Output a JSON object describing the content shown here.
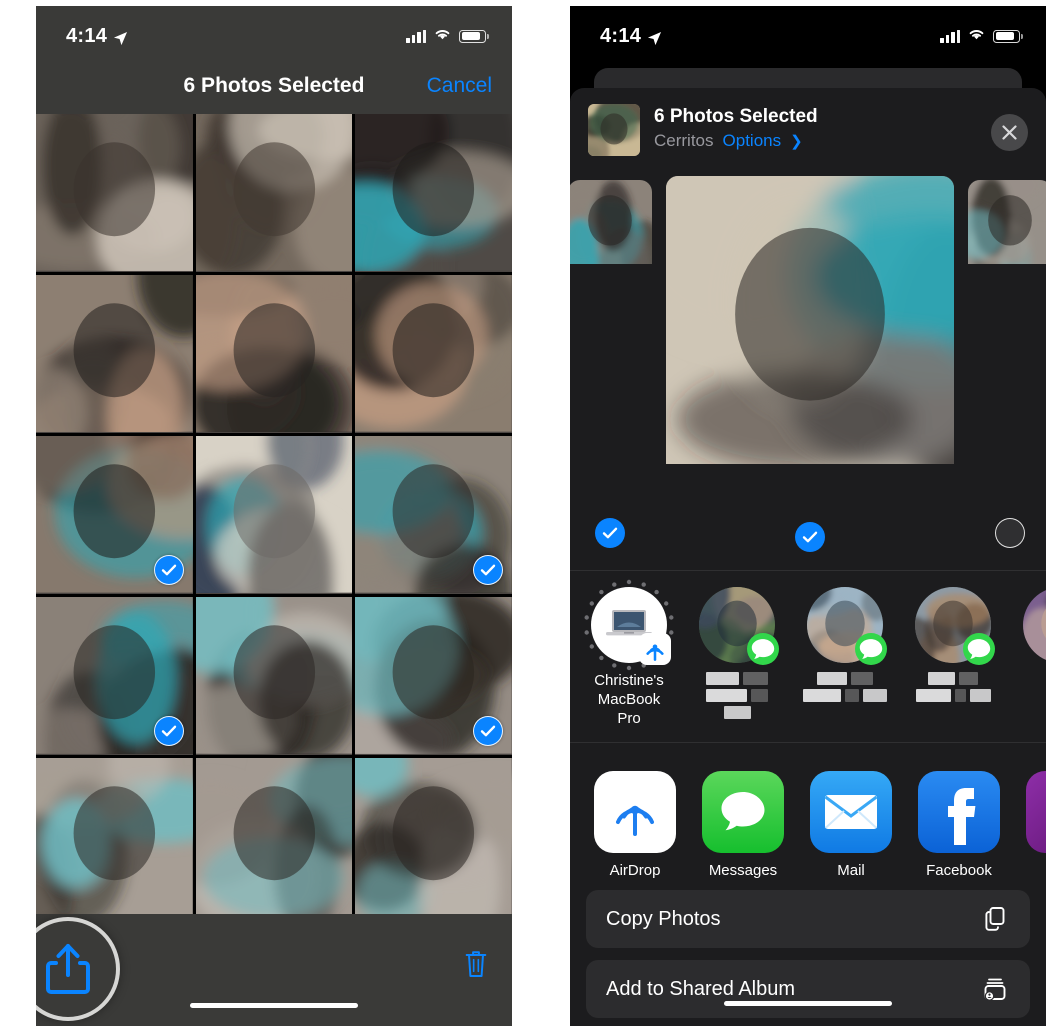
{
  "status_bar": {
    "time": "4:14",
    "location_icon": "location-arrow-icon",
    "signal_icon": "cellular-signal-icon",
    "wifi_icon": "wifi-icon",
    "battery_icon": "battery-icon"
  },
  "left_phone": {
    "nav": {
      "title": "6 Photos Selected",
      "cancel_label": "Cancel"
    },
    "grid": {
      "rows": 5,
      "columns": 3,
      "selected_count": 6,
      "cells": [
        {
          "id": "cell-1",
          "subject": "dog-paws-closeup",
          "selected": false
        },
        {
          "id": "cell-2",
          "subject": "dog-paws-closeup-2",
          "selected": false
        },
        {
          "id": "cell-3",
          "subject": "dog-in-teal-harness",
          "selected": false
        },
        {
          "id": "cell-4",
          "subject": "man-holding-dog",
          "selected": false
        },
        {
          "id": "cell-5",
          "subject": "man-holding-dog-2",
          "selected": false
        },
        {
          "id": "cell-6",
          "subject": "man-holding-dog-3",
          "selected": false
        },
        {
          "id": "cell-7",
          "subject": "man-kissing-dog",
          "selected": true
        },
        {
          "id": "cell-8",
          "subject": "dog-on-couch-mirror",
          "selected": false
        },
        {
          "id": "cell-9",
          "subject": "dog-sitting-couch",
          "selected": true
        },
        {
          "id": "cell-10",
          "subject": "dog-sitting-couch-2",
          "selected": true
        },
        {
          "id": "cell-11",
          "subject": "dog-lying-blanket",
          "selected": false
        },
        {
          "id": "cell-12",
          "subject": "dog-lying-blanket-2",
          "selected": true
        },
        {
          "id": "cell-13",
          "subject": "dog-resting-bed",
          "selected": false
        },
        {
          "id": "cell-14",
          "subject": "dog-resting-bed-2",
          "selected": false
        },
        {
          "id": "cell-15",
          "subject": "dog-resting-bed-3",
          "selected": false
        }
      ]
    },
    "toolbar": {
      "share_icon": "share-icon",
      "trash_icon": "trash-icon",
      "share_highlighted": true
    }
  },
  "right_phone": {
    "sheet": {
      "title": "6 Photos Selected",
      "subtitle": "Cerritos",
      "options_label": "Options",
      "options_chevron": "chevron-right-icon",
      "close_icon": "close-icon",
      "thumbnail": "dog-outdoor-thumbnail"
    },
    "preview": [
      {
        "id": "preview-left",
        "subject": "dog-sitting-couch-partial",
        "selected": true,
        "size": "side"
      },
      {
        "id": "preview-center",
        "subject": "dog-sitting-teal-harness",
        "selected": true,
        "size": "main"
      },
      {
        "id": "preview-right",
        "subject": "dog-lying-blanket-partial",
        "selected": false,
        "size": "side"
      }
    ],
    "airdrop": [
      {
        "id": "airdrop-macbook",
        "label": "Christine's MacBook Pro",
        "avatar": "macbook-pro-icon",
        "badge": "airdrop-icon",
        "redacted": false
      },
      {
        "id": "airdrop-contact-1",
        "label": "",
        "avatar": "contact-photo-man-outdoors",
        "badge": "messages-icon",
        "redacted": true
      },
      {
        "id": "airdrop-contact-2",
        "label": "",
        "avatar": "contact-photo-couple-lake",
        "badge": "messages-icon",
        "redacted": true
      },
      {
        "id": "airdrop-contact-3",
        "label": "",
        "avatar": "contact-photo-group",
        "badge": "messages-icon",
        "redacted": true
      },
      {
        "id": "airdrop-contact-4",
        "label": "",
        "avatar": "contact-photo-partial",
        "badge": "",
        "redacted": false
      }
    ],
    "apps": [
      {
        "id": "app-airdrop",
        "label": "AirDrop",
        "icon": "airdrop-icon",
        "color": "#ffffff"
      },
      {
        "id": "app-messages",
        "label": "Messages",
        "icon": "messages-icon",
        "color": "#32d74b"
      },
      {
        "id": "app-mail",
        "label": "Mail",
        "icon": "mail-icon",
        "color": "#1d9bf5"
      },
      {
        "id": "app-facebook",
        "label": "Facebook",
        "icon": "facebook-icon",
        "color": "#1877f2"
      },
      {
        "id": "app-more",
        "label": "",
        "icon": "flickr-icon",
        "color": "#7b1fa2"
      }
    ],
    "actions": [
      {
        "id": "action-copy-photos",
        "label": "Copy Photos",
        "icon": "copy-icon"
      },
      {
        "id": "action-shared-album",
        "label": "Add to Shared Album",
        "icon": "shared-album-icon"
      }
    ]
  },
  "colors": {
    "accent_blue": "#0a84ff",
    "messages_green": "#32d74b",
    "sheet_bg": "#1c1c1e",
    "row_bg": "#2c2c2e",
    "left_chrome": "#3a3a38"
  }
}
